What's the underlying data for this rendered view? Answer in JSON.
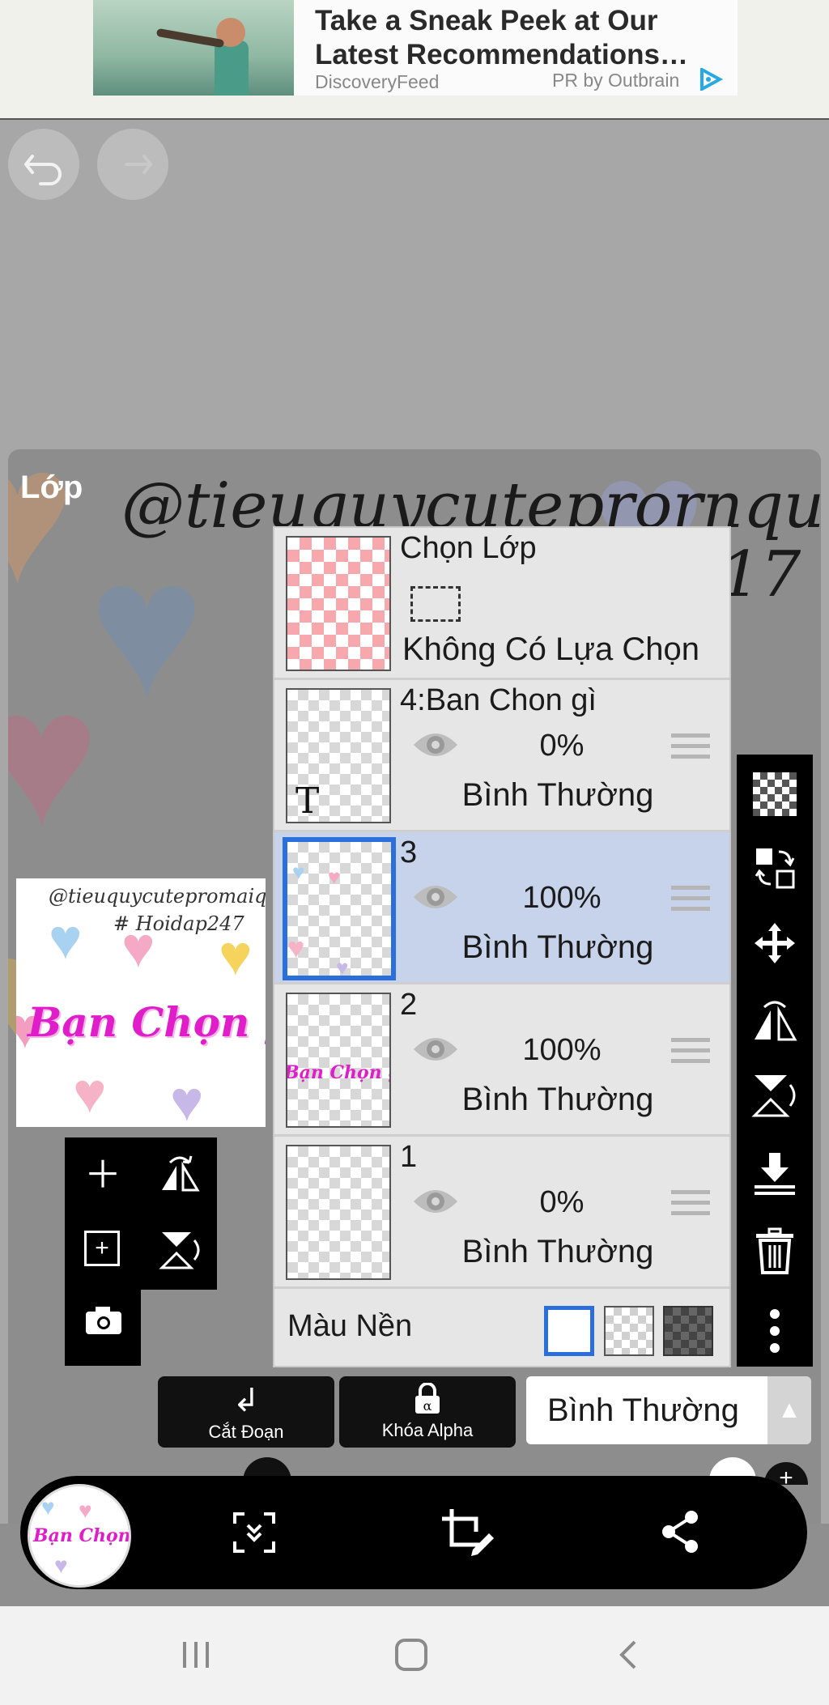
{
  "ad": {
    "title_line1": "Take a Sneak Peek at Our",
    "title_line2": "Latest Recommendations…",
    "source": "DiscoveryFeed",
    "sponsor": "PR by Outbrain"
  },
  "canvas_text": {
    "handwriting": "@tieuquycuteprornque",
    "suffix": "17"
  },
  "panel_title": "Lớp",
  "preview": {
    "line1": "@tieuquycutepromaique",
    "line2": "# Hoidap247",
    "art": "Bạn Chọn gì"
  },
  "layers": {
    "selection": {
      "title": "Chọn Lớp",
      "subtitle": "Không Có Lựa Chọn"
    },
    "items": [
      {
        "name": "4:Ban Chon gì",
        "opacity": "0%",
        "blend": "Bình Thường",
        "glyph": "T"
      },
      {
        "name": "3",
        "opacity": "100%",
        "blend": "Bình Thường"
      },
      {
        "name": "2",
        "opacity": "100%",
        "blend": "Bình Thường",
        "art": "Bạn Chọn gì"
      },
      {
        "name": "1",
        "opacity": "0%",
        "blend": "Bình Thường"
      }
    ],
    "background_label": "Màu Nền"
  },
  "actions": {
    "clip_label": "Cắt Đoạn",
    "alpha_label": "Khóa Alpha",
    "blend_mode": "Bình Thường"
  },
  "icons": {
    "undo": "undo-icon",
    "redo": "redo-icon",
    "visibility": "eye-icon",
    "drag": "drag-handle-icon",
    "transparent_layer": "checker-icon",
    "merge": "merge-icon",
    "move": "move-icon",
    "flip_h": "flip-horizontal-icon",
    "flip_v": "flip-vertical-icon",
    "merge_down": "merge-down-icon",
    "delete": "trash-icon",
    "more": "more-vertical-icon",
    "share": "share-icon",
    "fit": "fit-screen-icon",
    "crop": "crop-edit-icon"
  },
  "colors": {
    "selected_row": "#c6d3ea",
    "selection_border": "#2a6fdb",
    "accent_pink": "#e01ec9"
  }
}
